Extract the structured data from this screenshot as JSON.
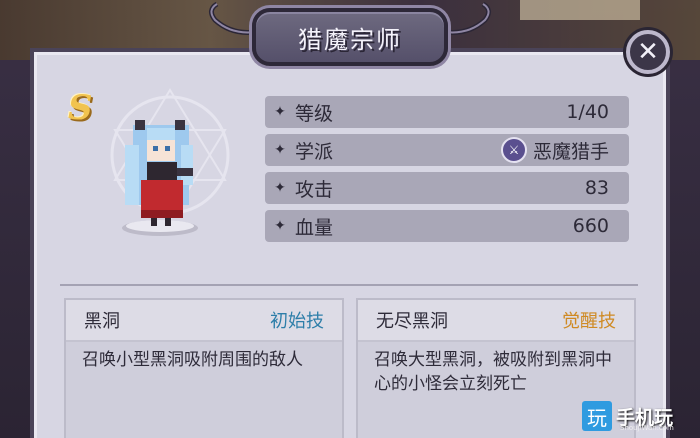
{
  "dialog": {
    "title": "猎魔宗师",
    "close_icon": "close-icon"
  },
  "hero": {
    "rank": "S",
    "sprite": "hero-sprite"
  },
  "stats": [
    {
      "label": "等级",
      "value": "1/40"
    },
    {
      "label": "学派",
      "value": "恶魔猎手",
      "icon": "demon-hunter-school-icon"
    },
    {
      "label": "攻击",
      "value": "83"
    },
    {
      "label": "血量",
      "value": "660"
    }
  ],
  "skills": [
    {
      "name": "黑洞",
      "tag": "初始技",
      "tag_color": "#2d7ea9",
      "desc": "召唤小型黑洞吸附周围的敌人"
    },
    {
      "name": "无尽黑洞",
      "tag": "觉醒技",
      "tag_color": "#cf8a23",
      "desc": "召唤大型黑洞，被吸附到黑洞中心的小怪会立刻死亡"
    }
  ],
  "watermark": {
    "glyph": "玩",
    "text": "手机玩",
    "sub": "ShoujiWan.com"
  }
}
